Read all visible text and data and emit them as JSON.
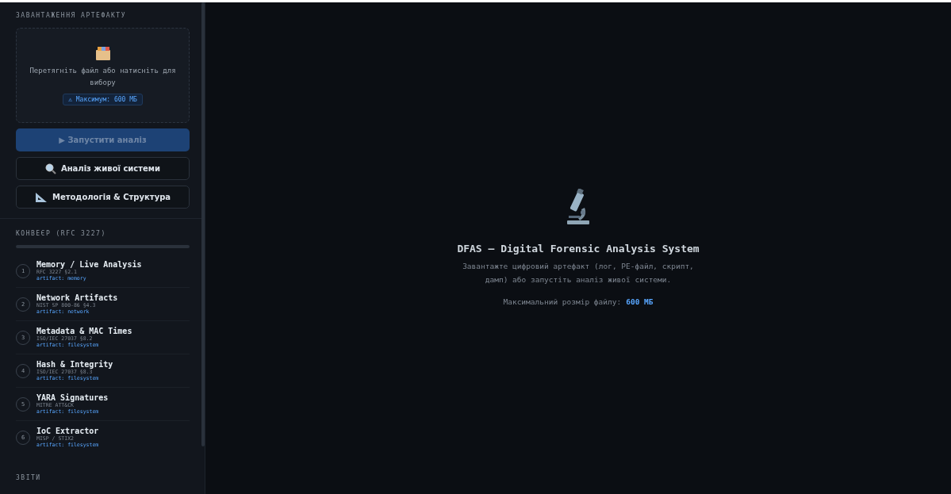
{
  "sidebar": {
    "upload": {
      "heading": "ЗАВАНТАЖЕННЯ АРТЕФАКТУ",
      "dropzone_text": "Перетягніть файл або натисніть для вибору",
      "limit_badge": "⚠ Максимум: 600 МБ"
    },
    "buttons": [
      {
        "kind": "primary",
        "label": "▶ Запустити аналіз",
        "disabled": true
      },
      {
        "kind": "search",
        "label": "Аналіз живої системи",
        "disabled": false
      },
      {
        "kind": "ruler",
        "label": "Методологія & Структура",
        "disabled": false
      }
    ],
    "pipeline": {
      "heading": "КОНВЕЄР (RFC 3227)",
      "steps": [
        {
          "number": "1",
          "title": "Memory / Live Analysis",
          "reference": "RFC 3227 §2.1",
          "artifact": "artifact: memory"
        },
        {
          "number": "2",
          "title": "Network Artifacts",
          "reference": "NIST SP 800-86 §4.3",
          "artifact": "artifact: network"
        },
        {
          "number": "3",
          "title": "Metadata & MAC Times",
          "reference": "ISO/IEC 27037 §8.2",
          "artifact": "artifact: filesystem"
        },
        {
          "number": "4",
          "title": "Hash & Integrity",
          "reference": "ISO/IEC 27037 §8.3",
          "artifact": "artifact: filesystem"
        },
        {
          "number": "5",
          "title": "YARA Signatures",
          "reference": "MITRE ATT&CK",
          "artifact": "artifact: filesystem"
        },
        {
          "number": "6",
          "title": "IoC Extractor",
          "reference": "MISP / STIX2",
          "artifact": "artifact: filesystem"
        }
      ]
    },
    "reports_heading": "ЗВІТИ"
  },
  "main": {
    "title": "DFAS — Digital Forensic Analysis System",
    "description": "Завантажте цифровий артефакт (лог, PE-файл, скрипт, дамп) або запустіть аналіз живої системи.",
    "max_size_label": "Максимальний розмір файлу:",
    "max_size_value": "600 МБ"
  }
}
